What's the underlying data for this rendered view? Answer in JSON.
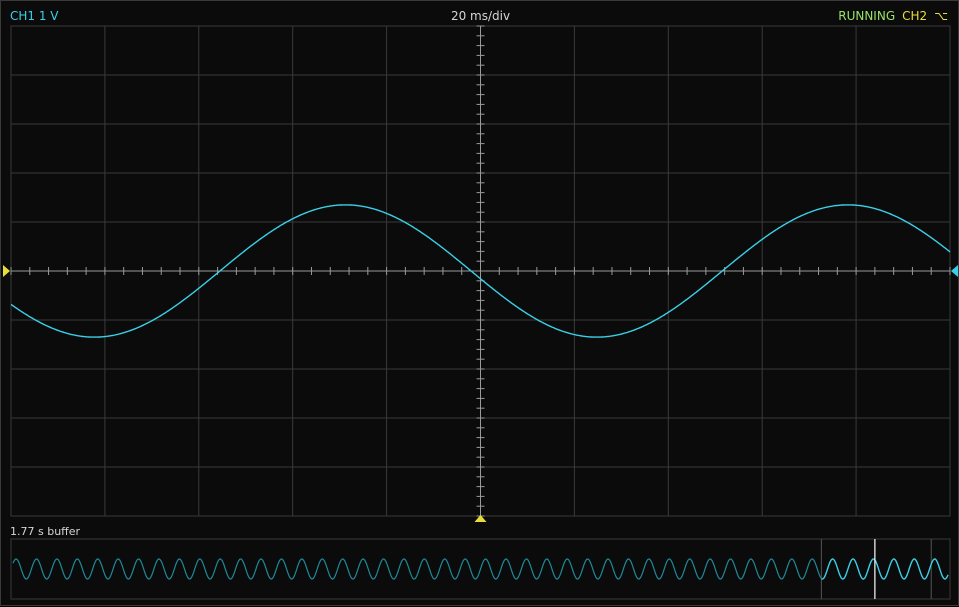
{
  "header": {
    "channel1_label": "CH1 1 V",
    "timebase": "20 ms/div",
    "run_status": "RUNNING",
    "channel2_label": "CH2",
    "trigger_slope_icon": "falling-edge-icon"
  },
  "overview": {
    "buffer_label": "1.77 s buffer"
  },
  "colors": {
    "channel1": "#3ad0e8",
    "channel2": "#e8dc3a",
    "running": "#9be26a",
    "grid": "#3a3a3a",
    "axis": "#9a9a9a"
  },
  "trace": {
    "volts_per_div": 1,
    "ms_per_div": 20,
    "amplitude_div": 1.35,
    "period_div": 5.35,
    "phase_div": -0.1,
    "overview_cycles": 46,
    "overview_window_start": 0.863,
    "overview_window_end": 0.98,
    "overview_cursor": 0.92
  }
}
